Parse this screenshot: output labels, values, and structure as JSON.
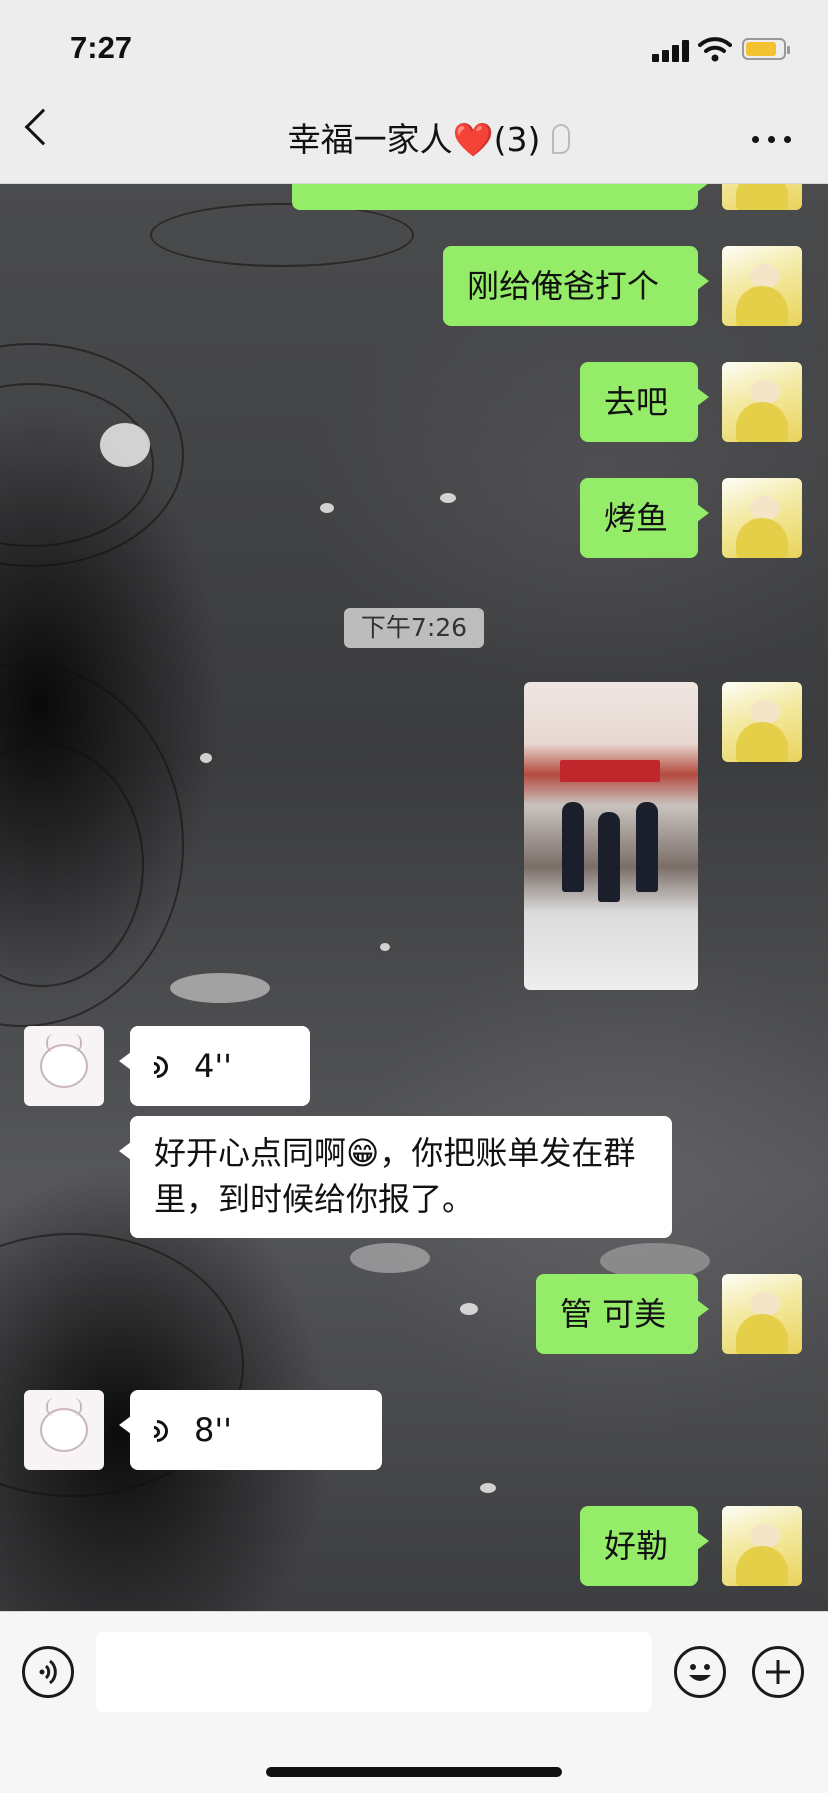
{
  "status_bar": {
    "time": "7:27"
  },
  "header": {
    "title": "幸福一家人",
    "heart": "❤️",
    "count": "(3)"
  },
  "messages": {
    "m1": "刚给俺爸打个",
    "m2": "去吧",
    "m3": "烤鱼",
    "timestamp": "下午7:26",
    "voice1": "4''",
    "long_text": "好开心点同啊😁，你把账单发在群里，到时候给你报了。",
    "m4": "管 可美",
    "voice2": "8''",
    "m5": "好勒"
  },
  "photo": {
    "sign_text": ""
  },
  "icons": [
    "back-arrow-icon",
    "ear-icon",
    "more-icon",
    "voice-mode-icon",
    "emoji-icon",
    "plus-icon"
  ]
}
